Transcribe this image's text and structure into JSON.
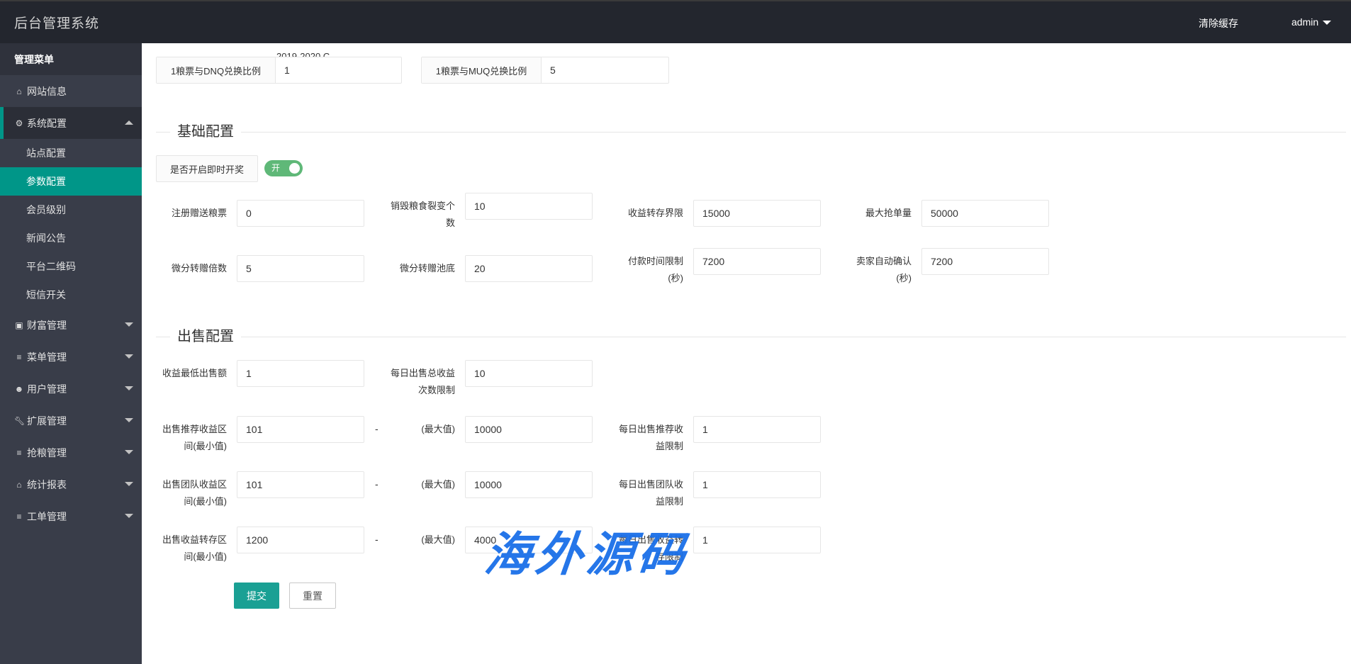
{
  "header": {
    "title": "后台管理系统",
    "clear_cache": "清除缓存",
    "user": "admin"
  },
  "sidebar": {
    "heading": "管理菜单",
    "items": [
      {
        "label": "网站信息",
        "icon": "home-icon"
      },
      {
        "label": "系统配置",
        "icon": "gears-icon",
        "expanded": true,
        "children": [
          "站点配置",
          "参数配置",
          "会员级别",
          "新闻公告",
          "平台二维码",
          "短信开关"
        ],
        "active_child": "参数配置"
      },
      {
        "label": "财富管理",
        "icon": "money-icon"
      },
      {
        "label": "菜单管理",
        "icon": "list-icon"
      },
      {
        "label": "用户管理",
        "icon": "users-icon"
      },
      {
        "label": "扩展管理",
        "icon": "wrench-icon"
      },
      {
        "label": "抢粮管理",
        "icon": "list-icon"
      },
      {
        "label": "统计报表",
        "icon": "home-icon"
      },
      {
        "label": "工单管理",
        "icon": "list-icon"
      }
    ]
  },
  "clipped_text": "2019-2020 C",
  "exchange": [
    {
      "label": "1粮票与DNQ兑换比例",
      "value": "1"
    },
    {
      "label": "1粮票与MUQ兑换比例",
      "value": "5"
    }
  ],
  "basic": {
    "title": "基础配置",
    "instant_draw_label": "是否开启即时开奖",
    "instant_draw_toggle": "开",
    "instant_draw_on": true,
    "fields": [
      {
        "label": "注册赠送粮票",
        "value": "0"
      },
      {
        "label": "销毁粮食裂变个数",
        "value": "10"
      },
      {
        "label": "收益转存界限",
        "value": "15000"
      },
      {
        "label": "最大抢单量",
        "value": "50000"
      },
      {
        "label": "微分转赠倍数",
        "value": "5"
      },
      {
        "label": "微分转赠池底",
        "value": "20"
      },
      {
        "label": "付款时间限制(秒)",
        "value": "7200"
      },
      {
        "label": "卖家自动确认(秒)",
        "value": "7200"
      }
    ]
  },
  "sale": {
    "title": "出售配置",
    "max_label": "(最大值)",
    "dash": "-",
    "fields": [
      {
        "label": "收益最低出售额",
        "value": "1"
      },
      {
        "label": "每日出售总收益次数限制",
        "value": "10"
      },
      {
        "label": "出售推荐收益区间(最小值)",
        "value": "101"
      },
      {
        "max": "10000"
      },
      {
        "label": "每日出售推荐收益限制",
        "value": "1"
      },
      {
        "label": "出售团队收益区间(最小值)",
        "value": "101"
      },
      {
        "max": "10000"
      },
      {
        "label": "每日出售团队收益限制",
        "value": "1"
      },
      {
        "label": "出售收益转存区间(最小值)",
        "value": "1200"
      },
      {
        "max": "4000"
      },
      {
        "label": "每日出售收益转存限制",
        "value": "1"
      }
    ]
  },
  "buttons": {
    "submit": "提交",
    "reset": "重置"
  },
  "watermark": "海外源码",
  "colors": {
    "accent": "#009688",
    "submit": "#1aa094",
    "toggle": "#5fb878",
    "header": "#23262e",
    "sidebar": "#393d49",
    "watermark": "#1a6fe8"
  }
}
